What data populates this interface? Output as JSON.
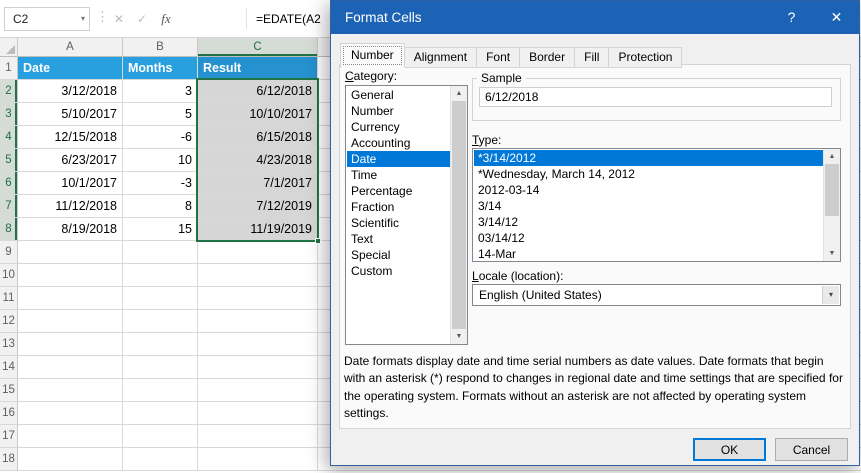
{
  "colors": {
    "titlebar": "#1d63b5",
    "header_fill": "#28a0e0",
    "selection_green": "#217346",
    "highlight_blue": "#0078d7",
    "selected_cell_fill": "#d6d6d6"
  },
  "icons": {
    "dropdown": "▾",
    "separator": "⋮",
    "cancel": "✕",
    "confirm": "✓",
    "fx": "fx",
    "help": "?",
    "close": "✕",
    "scroll_up": "▲",
    "scroll_down": "▼",
    "combo_arrow": "▾"
  },
  "excel": {
    "name_box": "C2",
    "formula": "=EDATE(A2",
    "columns": [
      "A",
      "B",
      "C"
    ],
    "selected_column": "C",
    "header_row": [
      "Date",
      "Months",
      "Result"
    ],
    "data_rows": [
      [
        "3/12/2018",
        "3",
        "6/12/2018"
      ],
      [
        "5/10/2017",
        "5",
        "10/10/2017"
      ],
      [
        "12/15/2018",
        "-6",
        "6/15/2018"
      ],
      [
        "6/23/2017",
        "10",
        "4/23/2018"
      ],
      [
        "10/1/2017",
        "-3",
        "7/1/2017"
      ],
      [
        "11/12/2018",
        "8",
        "7/12/2019"
      ],
      [
        "8/19/2018",
        "15",
        "11/19/2019"
      ]
    ],
    "total_rows": 18
  },
  "dialog": {
    "title": "Format Cells",
    "tabs": [
      "Number",
      "Alignment",
      "Font",
      "Border",
      "Fill",
      "Protection"
    ],
    "active_tab": "Number",
    "category": {
      "label": "Category:",
      "items": [
        "General",
        "Number",
        "Currency",
        "Accounting",
        "Date",
        "Time",
        "Percentage",
        "Fraction",
        "Scientific",
        "Text",
        "Special",
        "Custom"
      ],
      "selected": "Date"
    },
    "sample": {
      "label": "Sample",
      "value": "6/12/2018"
    },
    "type": {
      "label": "Type:",
      "items": [
        "*3/14/2012",
        "*Wednesday, March 14, 2012",
        "2012-03-14",
        "3/14",
        "3/14/12",
        "03/14/12",
        "14-Mar"
      ],
      "selected": "*3/14/2012"
    },
    "locale": {
      "label": "Locale (location):",
      "value": "English (United States)"
    },
    "description": "Date formats display date and time serial numbers as date values.  Date formats that begin with an asterisk (*) respond to changes in regional date and time settings that are specified for the operating system. Formats without an asterisk are not affected by operating system settings.",
    "buttons": {
      "ok": "OK",
      "cancel": "Cancel"
    }
  }
}
